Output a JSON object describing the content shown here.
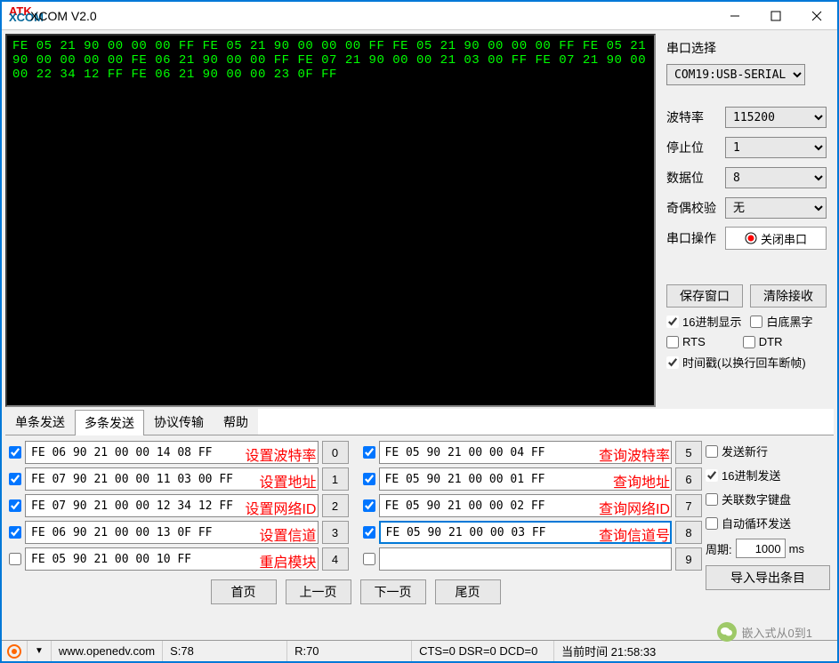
{
  "window": {
    "title": "XCOM V2.0",
    "logo_top": "ATK",
    "logo_bot": "XCOM"
  },
  "terminal": {
    "text": "FE 05 21 90 00 00 00 FF FE 05 21 90 00 00 00 FF FE 05 21 90 00 00 00 FF FE 05 21 90 00 00 00 00 FE 06 21 90 00 00 FF FE 07 21 90 00 00 21 03 00 FF FE 07 21 90 00 00 22 34 12 FF FE 06 21 90 00 00 23 0F FF"
  },
  "side": {
    "port_select_label": "串口选择",
    "port_value": "COM19:USB-SERIAL",
    "baud_label": "波特率",
    "baud_value": "115200",
    "stop_label": "停止位",
    "stop_value": "1",
    "data_label": "数据位",
    "data_value": "8",
    "parity_label": "奇偶校验",
    "parity_value": "无",
    "op_label": "串口操作",
    "close_btn": "关闭串口",
    "save_btn": "保存窗口",
    "clear_btn": "清除接收",
    "hex_disp": "16进制显示",
    "white_bg": "白底黑字",
    "rts": "RTS",
    "dtr": "DTR",
    "timestamp": "时间戳(以换行回车断帧)"
  },
  "tabs": [
    "单条发送",
    "多条发送",
    "协议传输",
    "帮助"
  ],
  "rows_left": [
    {
      "chk": true,
      "txt": "FE 06 90 21 00 00 14 08 FF",
      "label": "设置波特率",
      "btn": "0"
    },
    {
      "chk": true,
      "txt": "FE 07 90 21 00 00 11 03 00 FF",
      "label": "设置地址",
      "btn": "1"
    },
    {
      "chk": true,
      "txt": "FE 07 90 21 00 00 12 34 12 FF",
      "label": "设置网络ID",
      "btn": "2"
    },
    {
      "chk": true,
      "txt": "FE 06 90 21 00 00 13 0F FF",
      "label": "设置信道",
      "btn": "3"
    },
    {
      "chk": false,
      "txt": "FE 05 90 21 00 00 10 FF",
      "label": "重启模块",
      "btn": "4"
    }
  ],
  "rows_right": [
    {
      "chk": true,
      "txt": "FE 05 90 21 00 00 04 FF",
      "label": "查询波特率",
      "btn": "5"
    },
    {
      "chk": true,
      "txt": "FE 05 90 21 00 00 01 FF",
      "label": "查询地址",
      "btn": "6"
    },
    {
      "chk": true,
      "txt": "FE 05 90 21 00 00 02 FF",
      "label": "查询网络ID",
      "btn": "7"
    },
    {
      "chk": true,
      "txt": "FE 05 90 21 00 00 03 FF",
      "label": "查询信道号",
      "btn": "8",
      "sel": true
    },
    {
      "chk": false,
      "txt": "",
      "label": "",
      "btn": "9"
    }
  ],
  "nav": {
    "home": "首页",
    "prev": "上一页",
    "next": "下一页",
    "last": "尾页"
  },
  "opts": {
    "send_newline": "发送新行",
    "hex_send": "16进制发送",
    "numpad": "关联数字键盘",
    "auto_loop": "自动循环发送",
    "period_label": "周期:",
    "period_value": "1000",
    "period_unit": "ms",
    "export_btn": "导入导出条目"
  },
  "status": {
    "url": "www.openedv.com",
    "s": "S:78",
    "r": "R:70",
    "sig": "CTS=0 DSR=0 DCD=0",
    "time": "当前时间 21:58:33"
  },
  "watermark": "嵌入式从0到1"
}
